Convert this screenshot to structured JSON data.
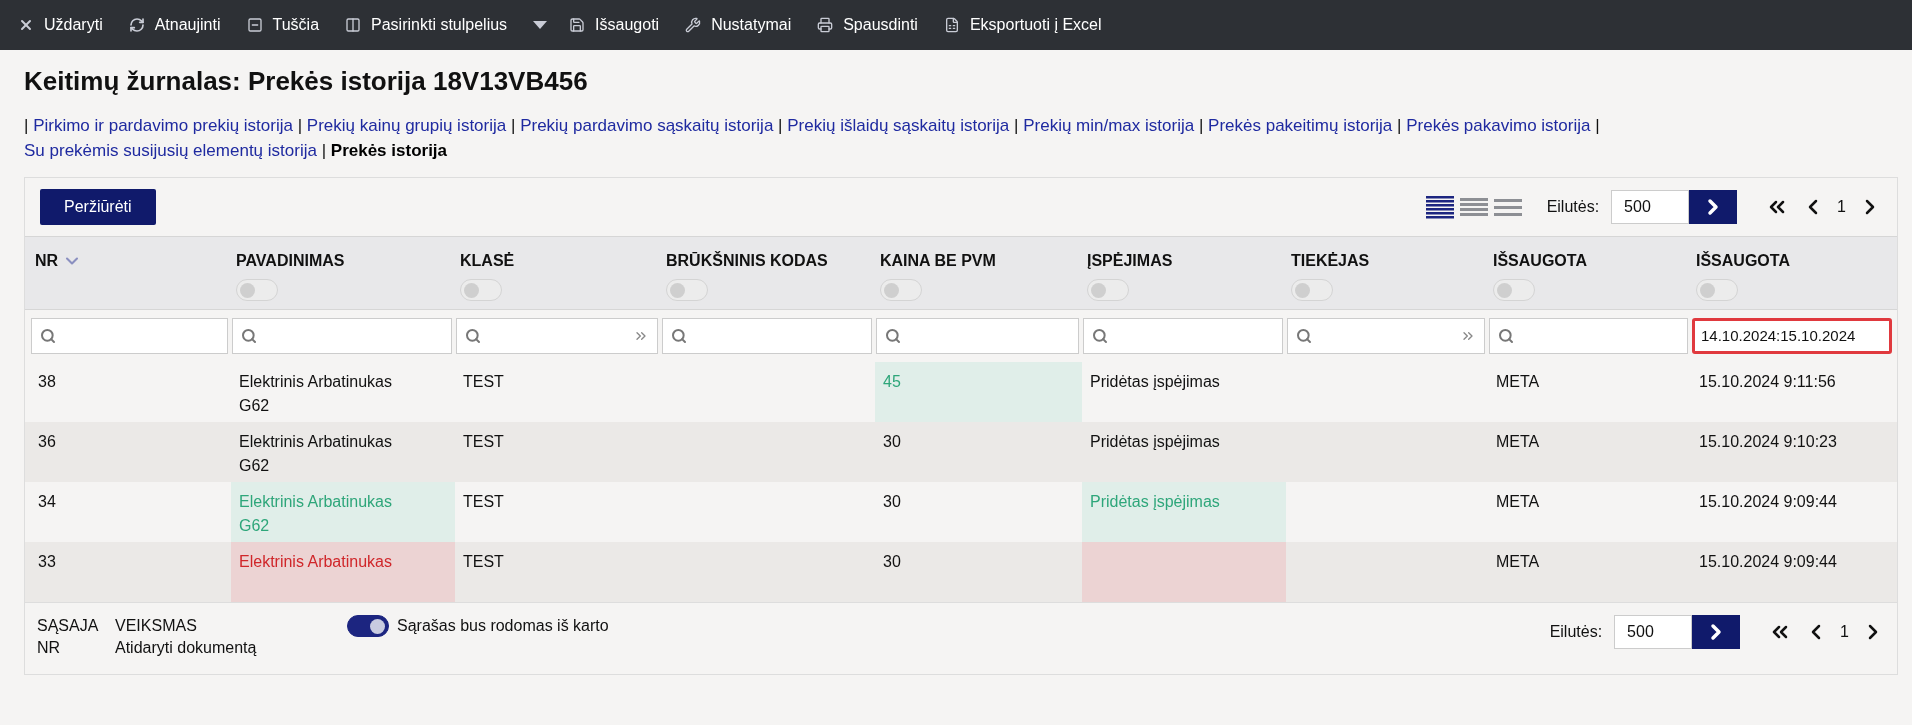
{
  "toolbar": [
    "Uždaryti",
    "Atnaujinti",
    "Tuščia",
    "Pasirinkti stulpelius",
    "Išsaugoti",
    "Nustatymai",
    "Spausdinti",
    "Eksportuoti į Excel"
  ],
  "title": "Keitimų žurnalas: Prekės istorija 18V13VB456",
  "links": [
    {
      "separator": "|",
      "label": "Pirkimo ir pardavimo prekių istorija",
      "selected": false
    },
    {
      "separator": "|",
      "label": "Prekių kainų grupių istorija",
      "selected": false
    },
    {
      "separator": "|",
      "label": "Prekių pardavimo sąskaitų istorija",
      "selected": false
    },
    {
      "separator": "|",
      "label": "Prekių išlaidų sąskaitų istorija",
      "selected": false
    },
    {
      "separator": "|",
      "label": "Prekių min/max istorija",
      "selected": false
    },
    {
      "separator": "|",
      "label": "Prekės pakeitimų istorija",
      "selected": false
    },
    {
      "separator": "|",
      "label": "Prekės pakavimo istorija",
      "selected": false
    },
    {
      "separator": "|",
      "label": "Su prekėmis susijusių elementų istorija",
      "selected": false
    },
    {
      "separator": "|",
      "label": "Prekės istorija",
      "selected": true
    }
  ],
  "view_button": "Peržiūrėti",
  "density": [
    {
      "selected": true
    },
    {
      "selected": false
    },
    {
      "selected": false
    }
  ],
  "rows_label": "Eilutės:",
  "rows_value": "500",
  "page": "1",
  "columns": [
    {
      "label": "NR",
      "sorted": true
    },
    {
      "label": "PAVADINIMAS",
      "sorted": false,
      "toggle": false
    },
    {
      "label": "KLASĖ",
      "sorted": false,
      "toggle": false
    },
    {
      "label": "BRŪKŠNINIS KODAS",
      "sorted": false,
      "toggle": false
    },
    {
      "label": "KAINA BE PVM",
      "sorted": false,
      "toggle": false
    },
    {
      "label": "ĮSPĖJIMAS",
      "sorted": false,
      "toggle": false
    },
    {
      "label": "TIEKĖJAS",
      "sorted": false,
      "toggle": false
    },
    {
      "label": "IŠSAUGOTA",
      "sorted": false,
      "toggle": false
    },
    {
      "label": "IŠSAUGOTA",
      "sorted": false,
      "toggle": false
    }
  ],
  "filters": [
    {
      "expand": false,
      "highlighted": false
    },
    {
      "expand": false,
      "highlighted": false
    },
    {
      "expand": true,
      "highlighted": false
    },
    {
      "expand": false,
      "highlighted": false
    },
    {
      "expand": false,
      "highlighted": false
    },
    {
      "expand": false,
      "highlighted": false
    },
    {
      "expand": true,
      "highlighted": false
    },
    {
      "expand": false,
      "highlighted": false
    },
    {
      "value": "14.10.2024:15.10.2024",
      "expand": false,
      "highlighted": true
    }
  ],
  "rows": [
    {
      "cells": [
        {
          "text": "38",
          "kind": "plain"
        },
        {
          "text": "Elektrinis Arbatinukas G62",
          "kind": "plain"
        },
        {
          "text": "TEST",
          "kind": "plain"
        },
        {
          "kind": "plain"
        },
        {
          "text": "45",
          "kind": "added"
        },
        {
          "text": "Pridėtas įspėjimas",
          "kind": "plain"
        },
        {
          "kind": "plain"
        },
        {
          "text": "META",
          "kind": "plain"
        },
        {
          "text": "15.10.2024 9:11:56",
          "kind": "plain"
        }
      ]
    },
    {
      "cells": [
        {
          "text": "36",
          "kind": "plain"
        },
        {
          "text": "Elektrinis Arbatinukas G62",
          "kind": "plain"
        },
        {
          "text": "TEST",
          "kind": "plain"
        },
        {
          "kind": "plain"
        },
        {
          "text": "30",
          "kind": "plain"
        },
        {
          "text": "Pridėtas įspėjimas",
          "kind": "plain"
        },
        {
          "kind": "plain"
        },
        {
          "text": "META",
          "kind": "plain"
        },
        {
          "text": "15.10.2024 9:10:23",
          "kind": "plain"
        }
      ]
    },
    {
      "cells": [
        {
          "text": "34",
          "kind": "plain"
        },
        {
          "text": "Elektrinis Arbatinukas G62",
          "kind": "added"
        },
        {
          "text": "TEST",
          "kind": "plain"
        },
        {
          "kind": "plain"
        },
        {
          "text": "30",
          "kind": "plain"
        },
        {
          "text": "Pridėtas įspėjimas",
          "kind": "added"
        },
        {
          "kind": "plain"
        },
        {
          "text": "META",
          "kind": "plain"
        },
        {
          "text": "15.10.2024 9:09:44",
          "kind": "plain"
        }
      ]
    },
    {
      "cells": [
        {
          "text": "33",
          "kind": "plain"
        },
        {
          "text": "Elektrinis Arbatinukas",
          "kind": "removed"
        },
        {
          "text": "TEST",
          "kind": "plain"
        },
        {
          "kind": "plain"
        },
        {
          "text": "30",
          "kind": "plain"
        },
        {
          "kind": "removed"
        },
        {
          "kind": "plain"
        },
        {
          "text": "META",
          "kind": "plain"
        },
        {
          "text": "15.10.2024 9:09:44",
          "kind": "plain"
        }
      ]
    }
  ],
  "footer": {
    "legend_1": "SĄSAJA NR",
    "legend_2": "VEIKSMAS",
    "legend_3": "Atidaryti dokumentą",
    "list_toggle": {
      "label": "Sąrašas bus rodomas iš karto",
      "on": true
    },
    "rows_label": "Eilutės:",
    "rows_value": "500",
    "page": "1"
  }
}
